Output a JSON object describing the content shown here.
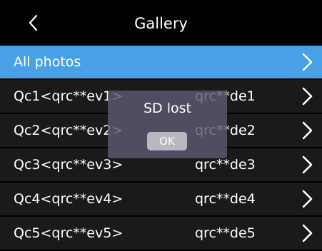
{
  "header": {
    "title": "Gallery",
    "back_icon": "chevron-left-icon"
  },
  "list": {
    "items": [
      {
        "label": "All photos",
        "code": "",
        "selected": true,
        "icon": "chevron-right-icon"
      },
      {
        "label": "Qc1<qrc**ev1>",
        "code": "qrc**de1",
        "selected": false,
        "icon": "chevron-right-icon"
      },
      {
        "label": "Qc2<qrc**ev2>",
        "code": "qrc**de2",
        "selected": false,
        "icon": "chevron-right-icon"
      },
      {
        "label": "Qc3<qrc**ev3>",
        "code": "qrc**de3",
        "selected": false,
        "icon": "chevron-right-icon"
      },
      {
        "label": "Qc4<qrc**ev4>",
        "code": "qrc**de4",
        "selected": false,
        "icon": "chevron-right-icon"
      },
      {
        "label": "Qc5<qrc**ev5>",
        "code": "qrc**de5",
        "selected": false,
        "icon": "chevron-right-icon"
      }
    ]
  },
  "dialog": {
    "message": "SD lost",
    "ok_label": "OK"
  },
  "colors": {
    "background": "#000000",
    "row": "#1a1a1a",
    "selected": "#4aa0e6",
    "dialog": "#5f5873",
    "ok_button": "#b8b8bf"
  }
}
